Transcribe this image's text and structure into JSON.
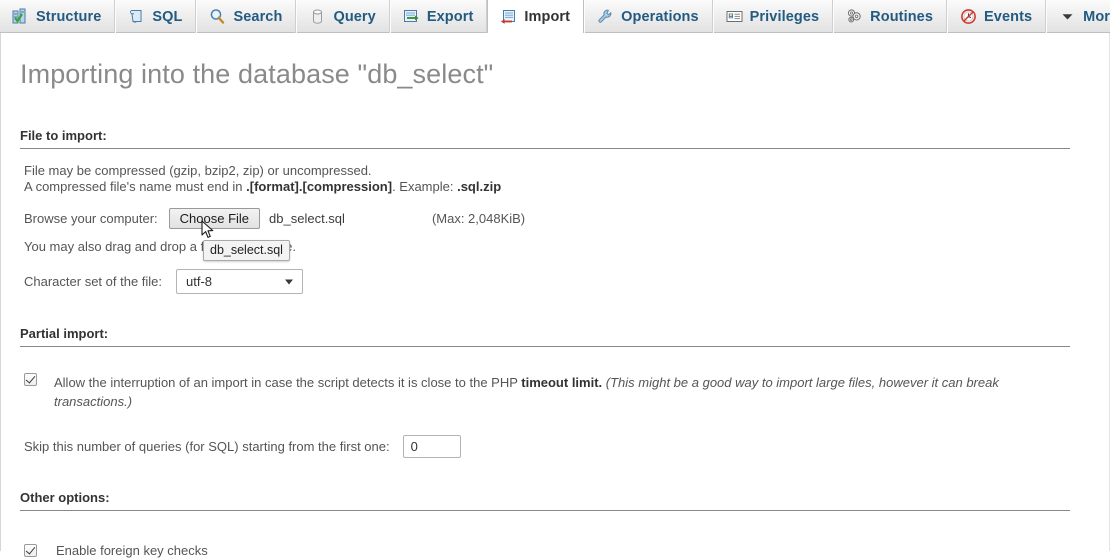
{
  "tabs": [
    {
      "id": "structure",
      "label": "Structure",
      "icon": "structure-icon",
      "active": false
    },
    {
      "id": "sql",
      "label": "SQL",
      "icon": "sql-icon",
      "active": false
    },
    {
      "id": "search",
      "label": "Search",
      "icon": "search-icon",
      "active": false
    },
    {
      "id": "query",
      "label": "Query",
      "icon": "query-icon",
      "active": false
    },
    {
      "id": "export",
      "label": "Export",
      "icon": "export-icon",
      "active": false
    },
    {
      "id": "import",
      "label": "Import",
      "icon": "import-icon",
      "active": true
    },
    {
      "id": "operations",
      "label": "Operations",
      "icon": "wrench-icon",
      "active": false
    },
    {
      "id": "privileges",
      "label": "Privileges",
      "icon": "privileges-icon",
      "active": false
    },
    {
      "id": "routines",
      "label": "Routines",
      "icon": "routines-icon",
      "active": false
    },
    {
      "id": "events",
      "label": "Events",
      "icon": "clock-icon",
      "active": false
    },
    {
      "id": "more",
      "label": "More",
      "icon": "chevron-down-icon",
      "active": false
    }
  ],
  "page": {
    "title": "Importing into the database \"db_select\""
  },
  "file_to_import": {
    "legend": "File to import:",
    "note_line_1": "File may be compressed (gzip, bzip2, zip) or uncompressed.",
    "note_line_2_prefix": "A compressed file's name must end in ",
    "note_line_2_bold_1": ".[format].[compression]",
    "note_line_2_mid": ". Example: ",
    "note_line_2_bold_2": ".sql.zip",
    "browse_label": "Browse your computer:",
    "choose_file_button": "Choose File",
    "selected_file": "db_select.sql",
    "max_size": "(Max: 2,048KiB)",
    "drag_drop_text": "You may also drag and drop a file on any page.",
    "tooltip": "db_select.sql",
    "charset_label": "Character set of the file:",
    "charset_value": "utf-8"
  },
  "partial_import": {
    "legend": "Partial import:",
    "allow_interruption_checked": true,
    "allow_interruption_text": "Allow the interruption of an import in case the script detects it is close to the PHP ",
    "allow_interruption_bold": "timeout limit.",
    "allow_interruption_italic": " (This might be a good way to import large files, however it can break transactions.)",
    "skip_label": "Skip this number of queries (for SQL) starting from the first one:",
    "skip_value": "0"
  },
  "other_options": {
    "legend": "Other options:",
    "foreign_key_checked": true,
    "foreign_key_label": "Enable foreign key checks"
  },
  "colors": {
    "tab_link": "#235a81",
    "heading": "#8a8a8a",
    "text": "#555555",
    "rule": "#888888"
  }
}
